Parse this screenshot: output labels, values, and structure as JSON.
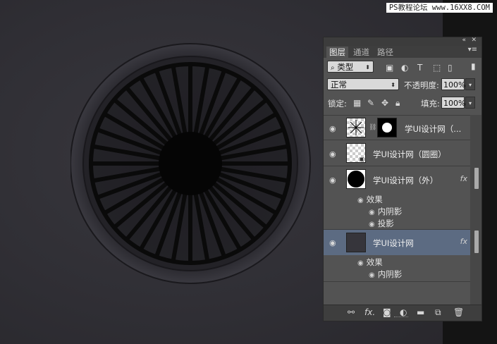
{
  "watermark": "PS教程论坛 www.16XX8.COM",
  "panel": {
    "collapse_icon": "double-chevron-icon",
    "close_icon": "close-icon",
    "tabs": [
      {
        "label": "图层",
        "active": true
      },
      {
        "label": "通道",
        "active": false
      },
      {
        "label": "路径",
        "active": false
      }
    ],
    "filter": {
      "label": "类型"
    },
    "blend": {
      "mode": "正常",
      "opacity_label": "不透明度:",
      "opacity_value": "100%"
    },
    "lock": {
      "label": "锁定:",
      "fill_label": "填充:",
      "fill_value": "100%"
    },
    "layers": [
      {
        "name": "学UI设计网（...",
        "has_mask": true,
        "fx": false
      },
      {
        "name": "学UI设计网（圆圈）",
        "has_mask": false,
        "fx": false
      },
      {
        "name": "学UI设计网（外）",
        "has_mask": false,
        "fx": true,
        "effects_label": "效果",
        "effects": [
          "内阴影",
          "投影"
        ]
      },
      {
        "name": "学UI设计网",
        "has_mask": false,
        "fx": true,
        "selected": true,
        "effects_label": "效果",
        "effects": [
          "内阴影"
        ]
      }
    ],
    "fx_glyph": "fx"
  },
  "colors": {
    "canvas": "#2e2d33",
    "panel": "#535353",
    "selection": "#5c6b82",
    "spokes": "#0a0a0a"
  }
}
